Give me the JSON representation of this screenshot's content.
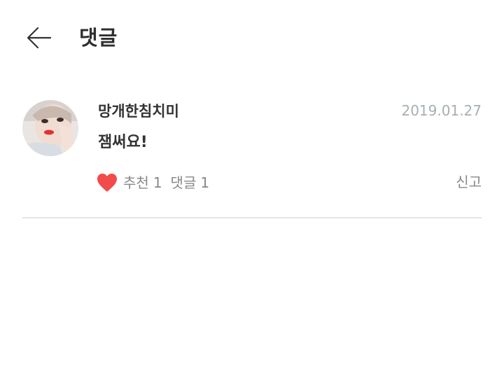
{
  "header": {
    "title": "댓글"
  },
  "comment": {
    "author": "망개한침치미",
    "date": "2019.01.27",
    "text": "잼써요!",
    "recommend_label": "추천",
    "recommend_count": "1",
    "reply_label": "댓글",
    "reply_count": "1",
    "report_label": "신고"
  },
  "icons": {
    "back": "arrow-left-icon",
    "like": "heart-icon"
  },
  "colors": {
    "heart": "#f24b4b",
    "date": "#a7afb3",
    "muted": "#888888",
    "divider": "#e4e4e4"
  }
}
